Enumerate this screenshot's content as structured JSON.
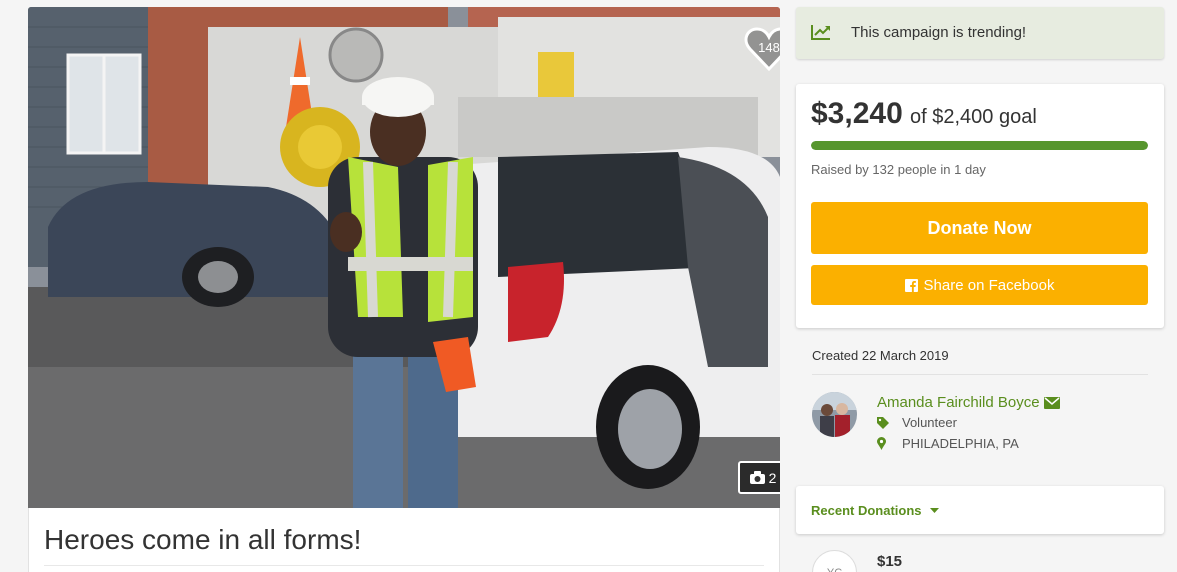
{
  "photo": {
    "heart_count": "148",
    "photo_count": "2"
  },
  "campaign": {
    "title": "Heroes come in all forms!"
  },
  "trending": {
    "text": "This campaign is trending!"
  },
  "funding": {
    "raised": "$3,240",
    "goal_text": "of $2,400 goal",
    "progress_percent": 100,
    "raised_by": "Raised by 132 people in 1 day",
    "donate_label": "Donate Now",
    "share_label": "Share on Facebook"
  },
  "organizer": {
    "created": "Created 22 March 2019",
    "name": "Amanda Fairchild Boyce",
    "role": "Volunteer",
    "location": "PHILADELPHIA, PA"
  },
  "donations": {
    "header": "Recent Donations",
    "first_amount": "$15",
    "first_initials": "YC"
  },
  "colors": {
    "accent_green": "#5a8e1e",
    "progress_green": "#57962e",
    "button_orange": "#fbb000",
    "trend_bg": "#e7ece0"
  }
}
